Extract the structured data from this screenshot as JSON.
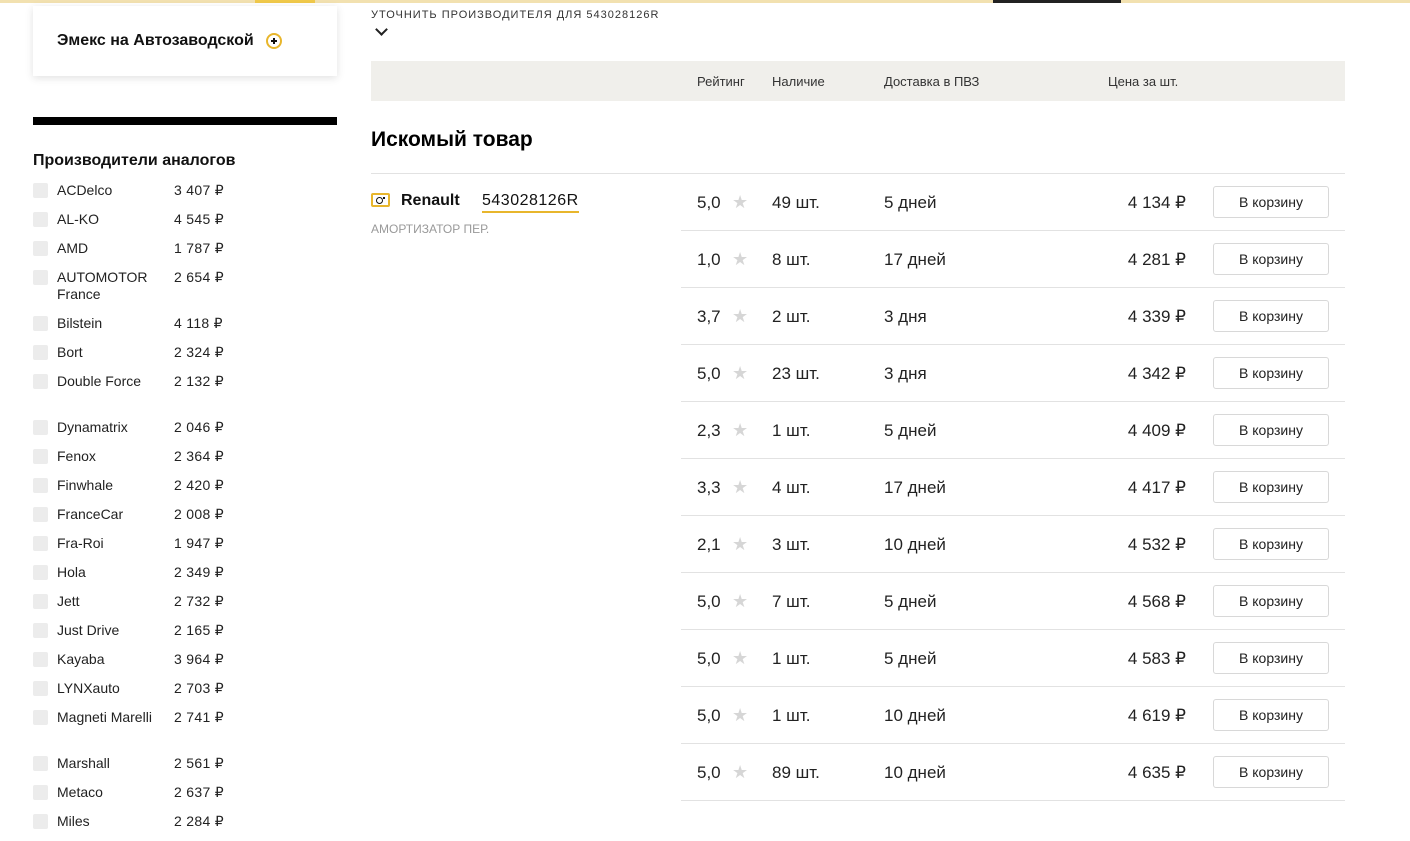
{
  "store": {
    "name": "Эмекс на Автозаводской"
  },
  "analogs": {
    "title": "Производители аналогов",
    "items": [
      {
        "name": "ACDelco",
        "price": "3 407 ₽"
      },
      {
        "name": "AL-KO",
        "price": "4 545 ₽"
      },
      {
        "name": "AMD",
        "price": "1 787 ₽"
      },
      {
        "name": "AUTOMOTOR France",
        "price": "2 654 ₽"
      },
      {
        "name": "Bilstein",
        "price": "4 118 ₽"
      },
      {
        "name": "Bort",
        "price": "2 324 ₽"
      },
      {
        "name": "Double Force",
        "price": "2 132 ₽"
      },
      {
        "name": "Dynamatrix",
        "price": "2 046 ₽"
      },
      {
        "name": "Fenox",
        "price": "2 364 ₽"
      },
      {
        "name": "Finwhale",
        "price": "2 420 ₽"
      },
      {
        "name": "FranceCar",
        "price": "2 008 ₽"
      },
      {
        "name": "Fra-Roi",
        "price": "1 947 ₽"
      },
      {
        "name": "Hola",
        "price": "2 349 ₽"
      },
      {
        "name": "Jett",
        "price": "2 732 ₽"
      },
      {
        "name": "Just Drive",
        "price": "2 165 ₽"
      },
      {
        "name": "Kayaba",
        "price": "3 964 ₽"
      },
      {
        "name": "LYNXauto",
        "price": "2 703 ₽"
      },
      {
        "name": "Magneti Marelli",
        "price": "2 741 ₽"
      },
      {
        "name": "Marshall",
        "price": "2 561 ₽"
      },
      {
        "name": "Metaco",
        "price": "2 637 ₽"
      },
      {
        "name": "Miles",
        "price": "2 284 ₽"
      }
    ]
  },
  "clarify": {
    "label": "УТОЧНИТЬ ПРОИЗВОДИТЕЛЯ ДЛЯ 543028126R"
  },
  "table_header": {
    "rating": "Рейтинг",
    "stock": "Наличие",
    "delivery": "Доставка в ПВЗ",
    "price": "Цена за шт."
  },
  "section": {
    "title": "Искомый товар"
  },
  "product": {
    "brand": "Renault",
    "part_number": "543028126R",
    "description": "АМОРТИЗАТОР ПЕР."
  },
  "cart_label": "В корзину",
  "offers": [
    {
      "rating": "5,0",
      "stock": "49 шт.",
      "delivery": "5 дней",
      "price": "4 134 ₽"
    },
    {
      "rating": "1,0",
      "stock": "8 шт.",
      "delivery": "17 дней",
      "price": "4 281 ₽"
    },
    {
      "rating": "3,7",
      "stock": "2 шт.",
      "delivery": "3 дня",
      "price": "4 339 ₽"
    },
    {
      "rating": "5,0",
      "stock": "23 шт.",
      "delivery": "3 дня",
      "price": "4 342 ₽"
    },
    {
      "rating": "2,3",
      "stock": "1 шт.",
      "delivery": "5 дней",
      "price": "4 409 ₽"
    },
    {
      "rating": "3,3",
      "stock": "4 шт.",
      "delivery": "17 дней",
      "price": "4 417 ₽"
    },
    {
      "rating": "2,1",
      "stock": "3 шт.",
      "delivery": "10 дней",
      "price": "4 532 ₽"
    },
    {
      "rating": "5,0",
      "stock": "7 шт.",
      "delivery": "5 дней",
      "price": "4 568 ₽"
    },
    {
      "rating": "5,0",
      "stock": "1 шт.",
      "delivery": "5 дней",
      "price": "4 583 ₽"
    },
    {
      "rating": "5,0",
      "stock": "1 шт.",
      "delivery": "10 дней",
      "price": "4 619 ₽"
    },
    {
      "rating": "5,0",
      "stock": "89 шт.",
      "delivery": "10 дней",
      "price": "4 635 ₽"
    }
  ]
}
